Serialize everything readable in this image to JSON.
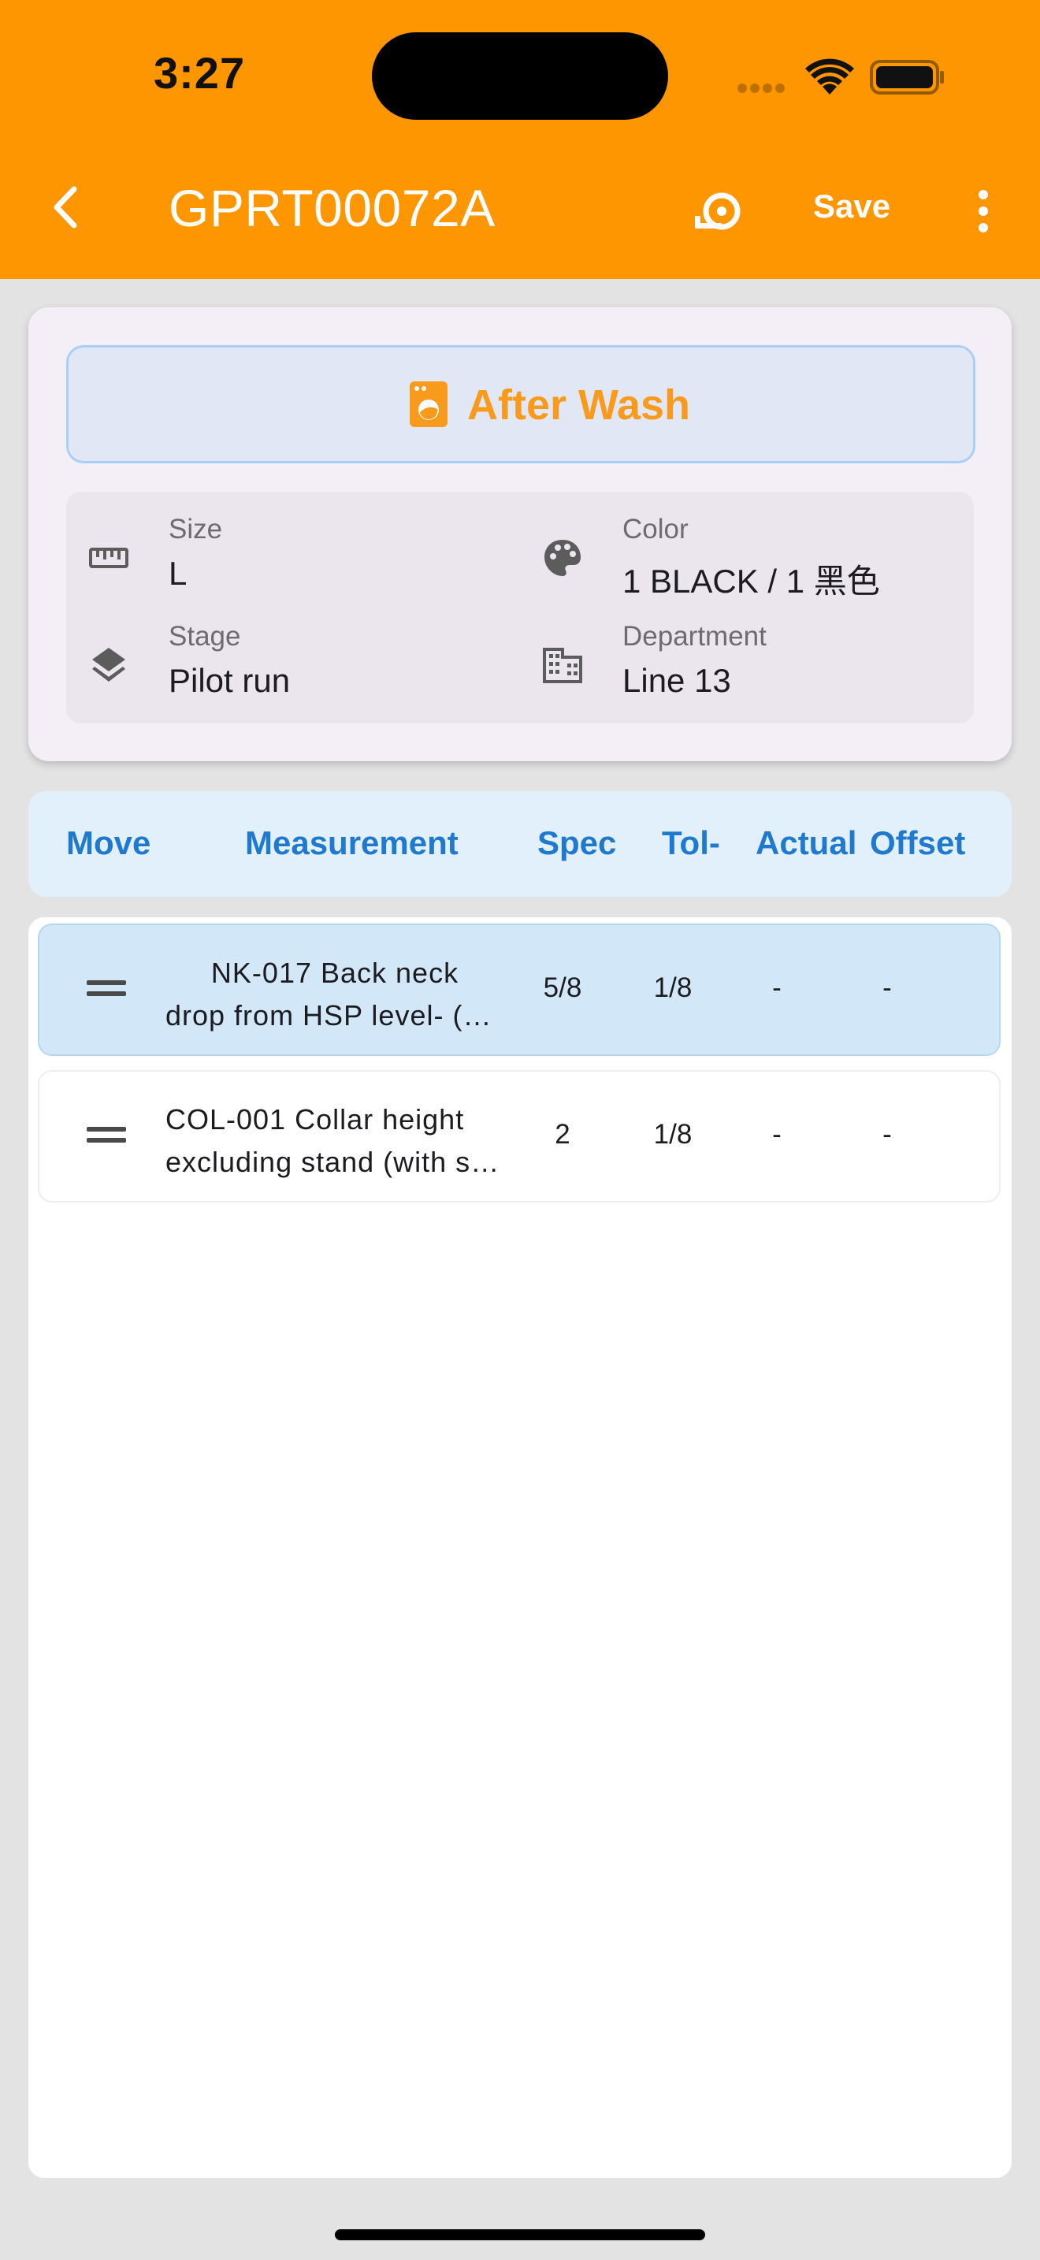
{
  "status_bar": {
    "time": "3:27"
  },
  "app_bar": {
    "title": "GPRT00072A",
    "save_label": "Save",
    "back_icon": "chevron-left-icon",
    "sync_icon": "sync-icon",
    "more_icon": "more-vert-icon",
    "background": "#fd9600"
  },
  "type_banner": {
    "label": "After Wash",
    "icon": "washing-machine-icon",
    "accent": "#f89a1c"
  },
  "details": {
    "size": {
      "label": "Size",
      "value": "L",
      "icon": "ruler-icon"
    },
    "color": {
      "label": "Color",
      "value": "1 BLACK / 1 黑色",
      "icon": "palette-icon"
    },
    "stage": {
      "label": "Stage",
      "value": "Pilot run",
      "icon": "layers-icon"
    },
    "department": {
      "label": "Department",
      "value": "Line 13",
      "icon": "building-icon"
    }
  },
  "table": {
    "headers": {
      "move": "Move",
      "measurement": "Measurement",
      "spec": "Spec",
      "tol": "Tol-",
      "actual": "Actual",
      "offset": "Offset"
    },
    "header_color": "#1f79cf",
    "rows": [
      {
        "line1": "NK-017   Back neck",
        "line2": "drop from HSP level- (Front)",
        "spec": "5/8",
        "tol": "1/8",
        "actual": "-",
        "offset": "-",
        "selected": true
      },
      {
        "line1": "COL-001  Collar height",
        "line2": "excluding stand (with stand)",
        "spec": "2",
        "tol": "1/8",
        "actual": "-",
        "offset": "-",
        "selected": false
      }
    ]
  }
}
